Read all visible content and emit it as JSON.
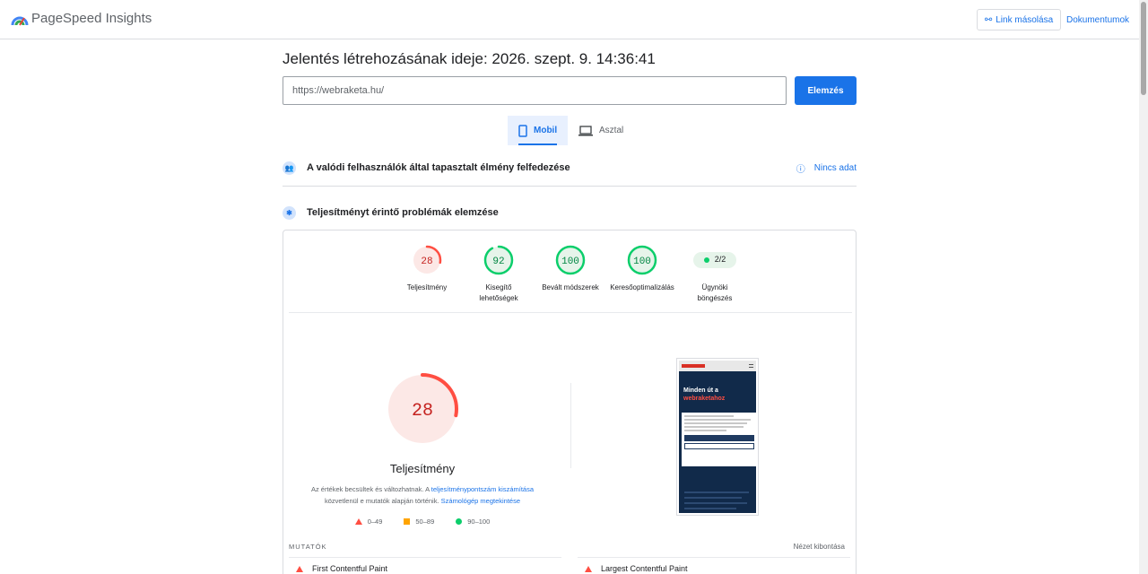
{
  "header": {
    "brand": "PageSpeed Insights",
    "copy_link_label": "Link másolása",
    "docs_label": "Dokumentumok"
  },
  "report": {
    "title": "Jelentés létrehozásának ideje: 2026. szept. 9. 14:36:41",
    "url_value": "https://webraketa.hu/",
    "analyze_label": "Elemzés"
  },
  "tabs": [
    {
      "label": "Mobil",
      "icon": "phone-icon",
      "selected": true
    },
    {
      "label": "Asztal",
      "icon": "laptop-icon",
      "selected": false
    }
  ],
  "sections": {
    "field_title": "A valódi felhasználók által tapasztalt élmény felfedezése",
    "no_data": "Nincs adat",
    "lab_title": "Teljesítményt érintő problémák elemzése"
  },
  "scores": [
    {
      "label": "Teljesítmény",
      "value": "28",
      "status": "poor",
      "fraction": 0.28
    },
    {
      "label": "Kisegítő lehetőségek",
      "value": "92",
      "status": "good",
      "fraction": 0.92
    },
    {
      "label": "Bevált módszerek",
      "value": "100",
      "status": "good",
      "fraction": 1.0
    },
    {
      "label": "Keresőoptimalizálás",
      "value": "100",
      "status": "good",
      "fraction": 1.0
    }
  ],
  "agent": {
    "label": "Ügynöki böngészés",
    "value": "2/2"
  },
  "performance": {
    "value": "28",
    "fraction": 0.28,
    "label": "Teljesítmény",
    "desc_1": "Az értékek becsültek és változhatnak. A ",
    "desc_link_1": "teljesítménypontszám kiszámítása",
    "desc_2": "közvetlenül e mutatók alapján történik. ",
    "desc_link_2": "Számológép megtekintése"
  },
  "legend": [
    {
      "range": "0–49",
      "shape": "triangle",
      "color": "#ff4e42"
    },
    {
      "range": "50–89",
      "shape": "square",
      "color": "#ffa400"
    },
    {
      "range": "90–100",
      "shape": "circle",
      "color": "#0cce6b"
    }
  ],
  "preview": {
    "headline_1": "Minden út a",
    "headline_2": "webraketahoz"
  },
  "metrics": {
    "heading": "MUTATÓK",
    "expand_label": "Nézet kibontása",
    "items": [
      {
        "label": "First Contentful Paint",
        "status": "poor"
      },
      {
        "label": "Largest Contentful Paint",
        "status": "poor"
      }
    ]
  },
  "colors": {
    "accent": "#1a73e8",
    "poor": "#ff4e42",
    "poor_text": "#c5221f",
    "good": "#0cce6b",
    "good_text": "#018642"
  }
}
